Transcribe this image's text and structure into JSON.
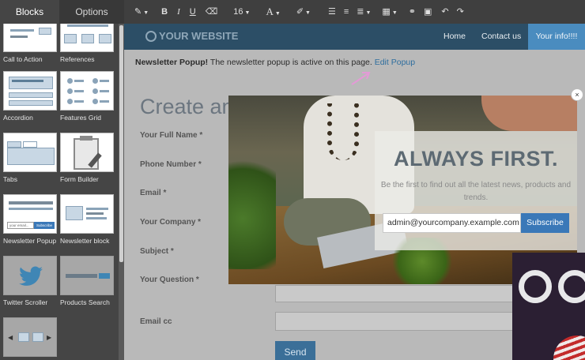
{
  "sidebar": {
    "tabs": [
      {
        "label": "Blocks"
      },
      {
        "label": "Options"
      }
    ],
    "blocks": [
      {
        "label": "Call to Action"
      },
      {
        "label": "References"
      },
      {
        "label": "Accordion"
      },
      {
        "label": "Features Grid"
      },
      {
        "label": "Tabs"
      },
      {
        "label": "Form Builder"
      },
      {
        "label": "Newsletter Popup",
        "thumb_input": "your email...",
        "thumb_button": "Subscribe"
      },
      {
        "label": "Newsletter block"
      },
      {
        "label": "Twitter Scroller"
      },
      {
        "label": "Products Search"
      },
      {
        "label": ""
      }
    ]
  },
  "toolbar": {
    "font_size": "16"
  },
  "site": {
    "logo": "YOUR WEBSITE",
    "nav": [
      {
        "label": "Home"
      },
      {
        "label": "Contact us"
      },
      {
        "label": "Your info!!!!"
      }
    ]
  },
  "notice": {
    "strong": "Newsletter Popup!",
    "text": " The newsletter popup is active on this page. ",
    "link": "Edit Popup"
  },
  "form": {
    "title": "Create an",
    "fields": [
      {
        "label": "Your Full Name *"
      },
      {
        "label": "Phone Number *"
      },
      {
        "label": "Email *"
      },
      {
        "label": "Your Company *"
      },
      {
        "label": "Subject *"
      },
      {
        "label": "Your Question *"
      },
      {
        "label": "Email cc"
      }
    ],
    "submit": "Send"
  },
  "popup": {
    "title": "ALWAYS FIRST.",
    "text": "Be the first to find out all the latest news, products and trends.",
    "email_value": "admin@yourcompany.example.com",
    "button": "Subscribe",
    "close": "×"
  },
  "colors": {
    "nav_bg": "#2c4e66",
    "accent": "#4a8cbf",
    "subscribe": "#3a78b8",
    "send": "#3b6f98"
  }
}
